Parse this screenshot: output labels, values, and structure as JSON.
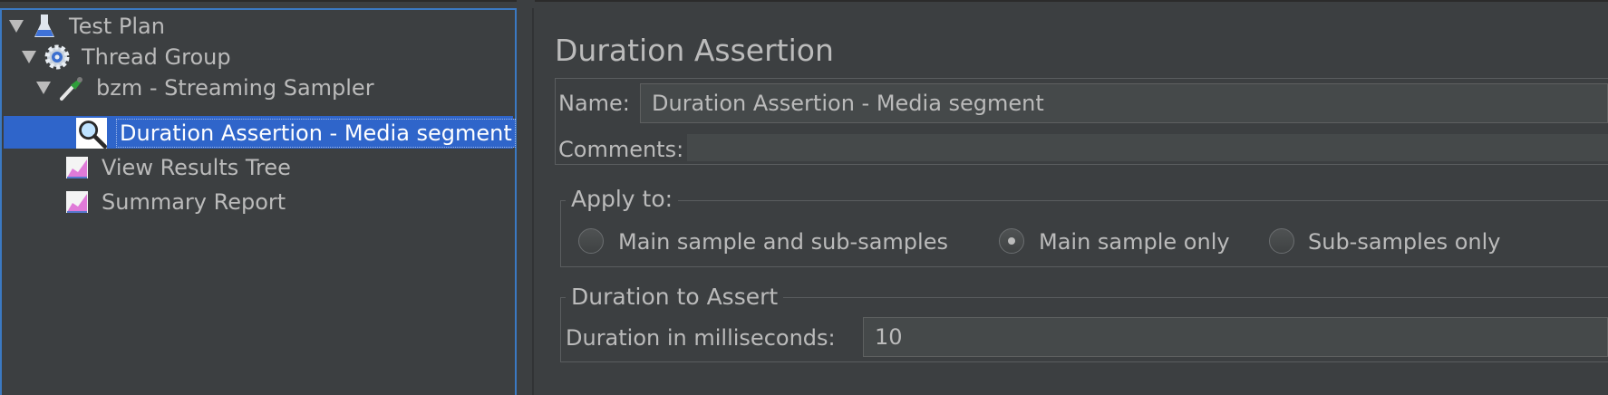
{
  "tree": {
    "items": [
      {
        "label": "Test Plan",
        "icon": "flask-icon"
      },
      {
        "label": "Thread Group",
        "icon": "gear-icon"
      },
      {
        "label": "bzm - Streaming Sampler",
        "icon": "pipette-icon"
      },
      {
        "label": "Duration Assertion - Media segment",
        "icon": "magnifier-icon"
      },
      {
        "label": "View Results Tree",
        "icon": "graph-icon"
      },
      {
        "label": "Summary Report",
        "icon": "graph-icon"
      }
    ]
  },
  "editor": {
    "title": "Duration Assertion",
    "name_label": "Name:",
    "name_value": "Duration Assertion - Media segment",
    "comments_label": "Comments:",
    "comments_value": "",
    "apply_to": {
      "legend": "Apply to:",
      "options": [
        "Main sample and sub-samples",
        "Main sample only",
        "Sub-samples only"
      ],
      "selected": "Main sample only"
    },
    "duration": {
      "legend": "Duration to Assert",
      "label": "Duration in milliseconds:",
      "value": "10"
    }
  },
  "colors": {
    "background": "#3c3f41",
    "selection": "#2f65ca",
    "focus_border": "#3b79c2",
    "text": "#bbbbbb"
  }
}
